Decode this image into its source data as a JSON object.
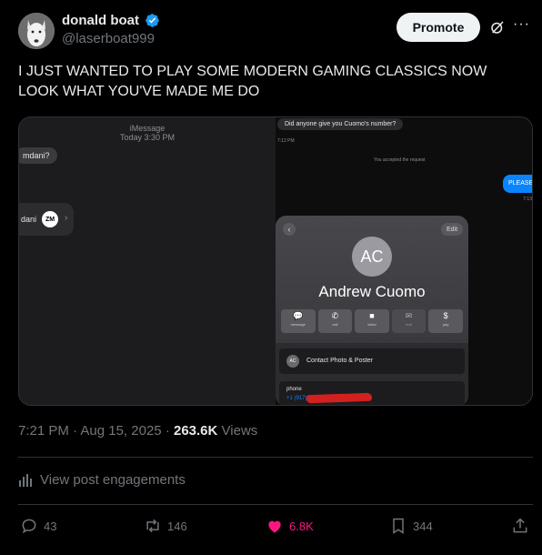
{
  "author": {
    "display_name": "donald boat",
    "handle": "@laserboat999",
    "verified": true
  },
  "header": {
    "promote_label": "Promote",
    "grok_icon": "grok-icon",
    "more_icon": "more-icon"
  },
  "post": {
    "text": "I JUST WANTED TO PLAY SOME MODERN GAMING CLASSICS NOW LOOK WHAT YOU'VE MADE ME DO"
  },
  "media": {
    "left": {
      "imessage_label": "iMessage",
      "timestamp": "Today 3:30 PM",
      "bubble_text": "mdani?",
      "chip_text": "dani",
      "chip_badge": "ZM"
    },
    "right": {
      "incoming_bubble": "Did anyone give you Cuomo's number?",
      "incoming_time": "7:12 PM",
      "system_note": "You accepted the request",
      "outgoing_bubble": "PLEASE",
      "outgoing_time": "7:13",
      "contact": {
        "back_icon": "chevron-left-icon",
        "edit_label": "Edit",
        "initials": "AC",
        "name": "Andrew Cuomo",
        "actions": [
          {
            "icon": "message-icon",
            "glyph": "💬",
            "label": "message"
          },
          {
            "icon": "phone-icon",
            "glyph": "✆",
            "label": "call"
          },
          {
            "icon": "video-icon",
            "glyph": "■",
            "label": "video"
          },
          {
            "icon": "mail-icon",
            "glyph": "✉",
            "label": "mail"
          },
          {
            "icon": "dollar-icon",
            "glyph": "$",
            "label": "pay"
          }
        ],
        "photo_badge": "AC",
        "photo_row_label": "Contact Photo & Poster",
        "phone_label": "phone",
        "phone_prefix": "+1 (917)"
      }
    }
  },
  "meta": {
    "time": "7:21 PM",
    "date": "Aug 15, 2025",
    "views_count": "263.6K",
    "views_label": "Views"
  },
  "engagements_label": "View post engagements",
  "actions": {
    "replies": "43",
    "reposts": "146",
    "likes": "6.8K",
    "bookmarks": "344"
  },
  "colors": {
    "background": "#000000",
    "text_primary": "#e7e9ea",
    "text_secondary": "#71767b",
    "like_pink": "#f91880",
    "verified_blue": "#1d9bf0",
    "imessage_blue": "#0a84ff",
    "redaction_red": "#d21f1f"
  }
}
